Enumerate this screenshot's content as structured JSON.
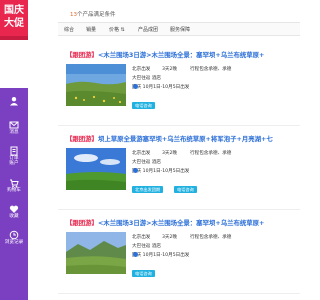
{
  "promo": {
    "logo_line1": "国庆",
    "logo_line2": "大促"
  },
  "sidebar": {
    "bg": "#7b3fc1",
    "items": [
      {
        "label": "",
        "icon": "user-icon"
      },
      {
        "label": "消息",
        "icon": "message-icon"
      },
      {
        "label": "订单",
        "icon": "order-icon"
      },
      {
        "label": "账户",
        "icon": "account-icon"
      },
      {
        "label": "购物车",
        "icon": "cart-icon"
      },
      {
        "label": "收藏",
        "icon": "heart-icon"
      },
      {
        "label": "浏览记录",
        "icon": "history-icon"
      }
    ]
  },
  "results": {
    "count": "13",
    "suffix": "个产品满足条件"
  },
  "tabs": [
    "综合",
    "销量",
    "价格",
    "产品成团",
    "服务保障"
  ],
  "products": [
    {
      "tag": "【跟团游】",
      "title": "<木兰围场3日游>木兰围场全景：塞罕坝+乌兰布统草原+",
      "departure": "北京出发",
      "days": "3天2晚",
      "route": "行程包含承德、承德",
      "hotel": "大巴往返 酒店",
      "dates": "国庆 10月1日-10月5日出发",
      "dates_note": "",
      "extra": "",
      "buttons": [
        "电话咨询"
      ]
    },
    {
      "tag": "【跟团游】",
      "title": "坝上草原全景游塞罕坝+乌兰布统草原+将军泡子+月亮湖+七",
      "departure": "北京出发",
      "days": "3天2晚",
      "route": "行程包含承德、承德",
      "hotel": "大巴往返 酒店",
      "dates": "国庆 10月1日-10月5日出发",
      "dates_note": "",
      "extra": "",
      "buttons": [
        "北京出发团期",
        "电话咨询"
      ]
    },
    {
      "tag": "【跟团游】",
      "title": "<木兰围场3日游>木兰围场全景：塞罕坝+乌兰布统草原+",
      "departure": "北京出发",
      "days": "3天2晚",
      "route": "行程包含承德、承德",
      "hotel": "大巴往返 酒店",
      "dates": "国庆 10月1日-10月5日出发",
      "dates_note": "",
      "extra": "",
      "buttons": [
        "电话咨询"
      ]
    }
  ]
}
